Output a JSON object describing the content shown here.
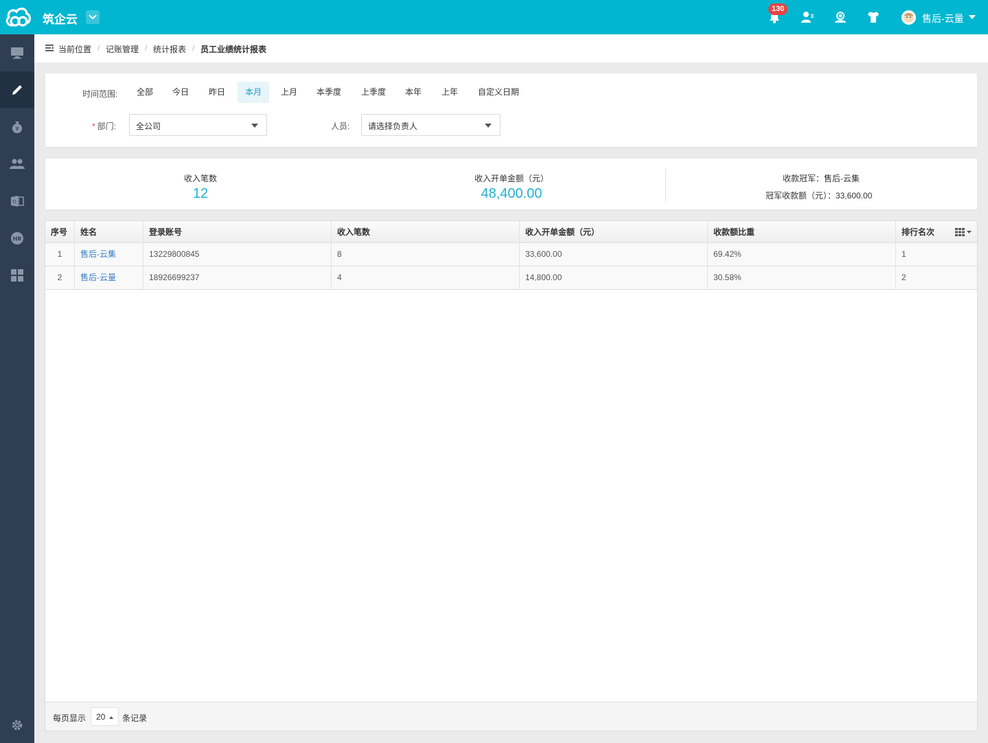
{
  "header": {
    "app_title": "筑企云",
    "notification_count": "130",
    "user_name": "售后-云量"
  },
  "sidebar": {
    "items": [
      {
        "icon": "monitor-icon"
      },
      {
        "icon": "pencil-icon",
        "active": true
      },
      {
        "icon": "money-bag-icon"
      },
      {
        "icon": "users-icon"
      },
      {
        "icon": "office-icon"
      },
      {
        "icon": "hr-icon"
      },
      {
        "icon": "grid-icon"
      }
    ],
    "bottom_icon": "gear-icon"
  },
  "breadcrumb": {
    "items": [
      "当前位置",
      "记账管理",
      "统计报表",
      "员工业绩统计报表"
    ]
  },
  "filters": {
    "time_range_label": "时间范围:",
    "time_options": [
      "全部",
      "今日",
      "昨日",
      "本月",
      "上月",
      "本季度",
      "上季度",
      "本年",
      "上年",
      "自定义日期"
    ],
    "active_time_option": "本月",
    "department_label": "部门:",
    "department_value": "全公司",
    "person_label": "人员:",
    "person_placeholder": "请选择负责人"
  },
  "stats": {
    "count_label": "收入笔数",
    "count_value": "12",
    "amount_label": "收入开单金额（元）",
    "amount_value": "48,400.00",
    "champion_line": "收款冠军：售后-云集",
    "champion_amount_line": "冠军收款额（元）：33,600.00"
  },
  "table": {
    "headers": [
      "序号",
      "姓名",
      "登录账号",
      "收入笔数",
      "收入开单金额（元）",
      "收款额比重",
      "排行名次"
    ],
    "rows": [
      [
        "1",
        "售后-云集",
        "13229800845",
        "8",
        "33,600.00",
        "69.42%",
        "1"
      ],
      [
        "2",
        "售后-云量",
        "18926699237",
        "4",
        "14,800.00",
        "30.58%",
        "2"
      ]
    ]
  },
  "pagination": {
    "per_page_label": "每页显示",
    "per_page_value": "20",
    "records_label": "条记录"
  },
  "colors": {
    "topbar": "#00b6d0",
    "sidebar": "#2f3e52",
    "accent_value": "#1fb2d2",
    "link": "#3b7fc4",
    "badge": "#e64545"
  }
}
